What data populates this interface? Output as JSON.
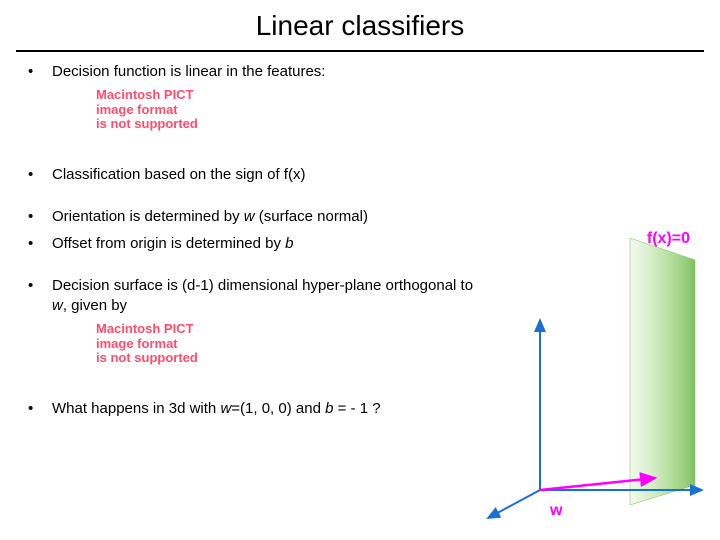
{
  "title": "Linear classifiers",
  "pict_error": {
    "l1": "Macintosh PICT",
    "l2": "image format",
    "l3": "is not supported"
  },
  "bullets": {
    "b1": "Decision function is linear in the features:",
    "b2": "Classification based on the sign of f(x)",
    "b3_pre": "Orientation is determined by ",
    "b3_w": "w",
    "b3_post": " (surface normal)",
    "b4_pre": "Offset from origin is determined by ",
    "b4_b": "b",
    "b5_pre": "Decision surface is (d-1) dimensional hyper-plane orthogonal to ",
    "b5_w": "w",
    "b5_post": ", given by",
    "b6_pre": "What happens in 3d with ",
    "b6_w": "w",
    "b6_mid": "=(1, 0, 0) and ",
    "b6_b": "b",
    "b6_post": " = - 1 ?"
  },
  "diagram": {
    "fx_label": "f(x)=0",
    "w_label": "w"
  },
  "dot": "•"
}
